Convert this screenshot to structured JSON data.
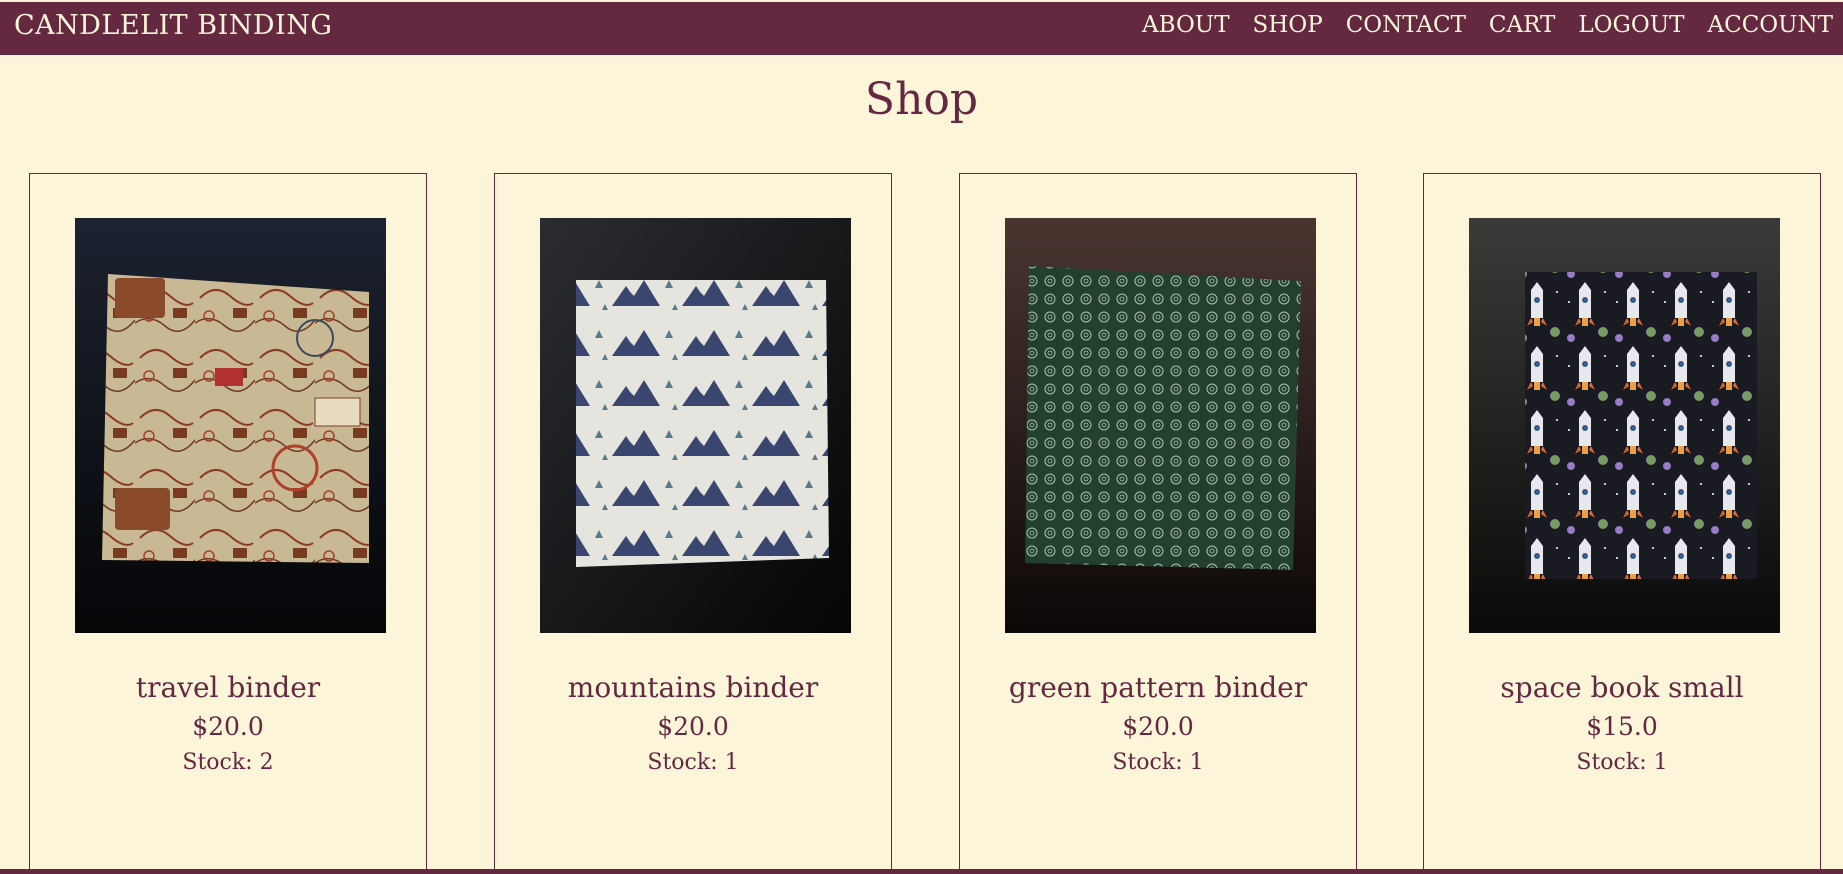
{
  "nav": {
    "brand": "CANDLELIT BINDING",
    "links": [
      "ABOUT",
      "SHOP",
      "CONTACT",
      "CART",
      "LOGOUT",
      "ACCOUNT"
    ]
  },
  "page": {
    "title": "Shop"
  },
  "products": [
    {
      "name": "travel binder",
      "price": "$20.0",
      "stock": "Stock: 2",
      "image": "travel-map-fabric-binder"
    },
    {
      "name": "mountains binder",
      "price": "$20.0",
      "stock": "Stock: 1",
      "image": "mountains-fabric-binder"
    },
    {
      "name": "green pattern binder",
      "price": "$20.0",
      "stock": "Stock: 1",
      "image": "green-swirl-fabric-binder"
    },
    {
      "name": "space book small",
      "price": "$15.0",
      "stock": "Stock: 1",
      "image": "rocket-space-fabric-book"
    }
  ],
  "colors": {
    "primary": "#642840",
    "background": "#FDF5DA"
  }
}
